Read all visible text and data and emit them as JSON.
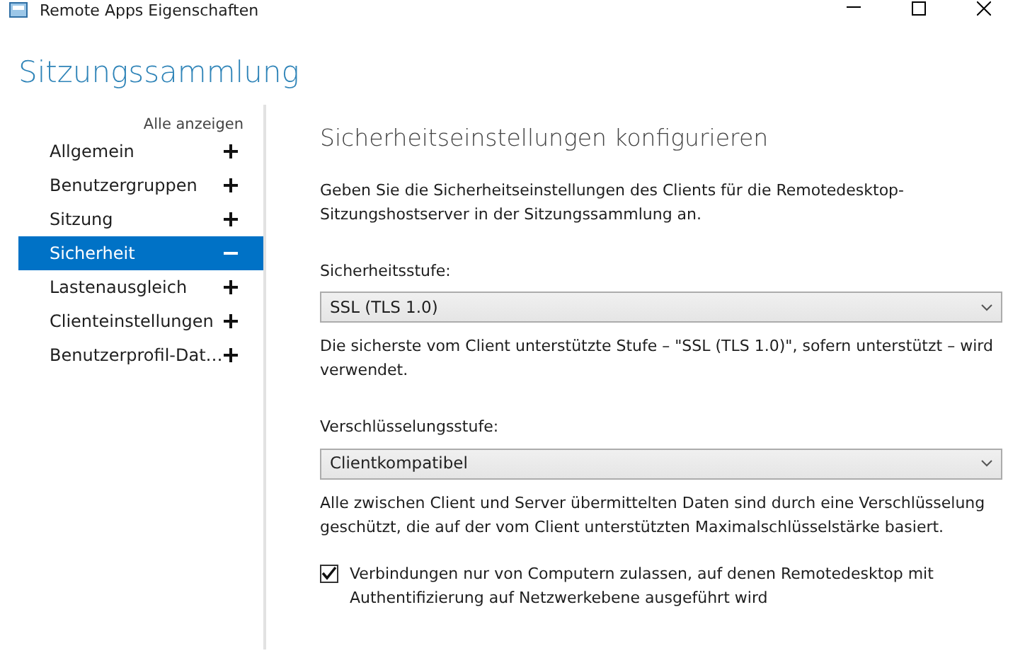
{
  "window": {
    "title": "Remote Apps Eigenschaften"
  },
  "heading": "Sitzungssammlung",
  "sidebar": {
    "show_all": "Alle anzeigen",
    "items": [
      {
        "label": "Allgemein",
        "expanded": false,
        "selected": false
      },
      {
        "label": "Benutzergruppen",
        "expanded": false,
        "selected": false
      },
      {
        "label": "Sitzung",
        "expanded": false,
        "selected": false
      },
      {
        "label": "Sicherheit",
        "expanded": true,
        "selected": true
      },
      {
        "label": "Lastenausgleich",
        "expanded": false,
        "selected": false
      },
      {
        "label": "Clienteinstellungen",
        "expanded": false,
        "selected": false
      },
      {
        "label": "Benutzerprofil-Dat…",
        "expanded": false,
        "selected": false
      }
    ]
  },
  "content": {
    "title": "Sicherheitseinstellungen konfigurieren",
    "intro": "Geben Sie die Sicherheitseinstellungen des Clients für die Remotedesktop-Sitzungshostserver in der Sitzungssammlung an.",
    "fields": [
      {
        "label": "Sicherheitsstufe:",
        "value": "SSL (TLS 1.0)",
        "description": "Die sicherste vom Client unterstützte Stufe – \"SSL (TLS 1.0)\", sofern unterstützt – wird verwendet."
      },
      {
        "label": "Verschlüsselungsstufe:",
        "value": "Clientkompatibel",
        "description": "Alle zwischen Client und Server übermittelten Daten sind durch eine Verschlüsselung geschützt, die auf der vom Client unterstützten Maximalschlüsselstärke basiert."
      }
    ],
    "checkbox": {
      "label": "Verbindungen nur von Computern zulassen, auf denen Remotedesktop mit Authentifizierung auf Netzwerkebene ausgeführt wird",
      "checked": true
    }
  }
}
